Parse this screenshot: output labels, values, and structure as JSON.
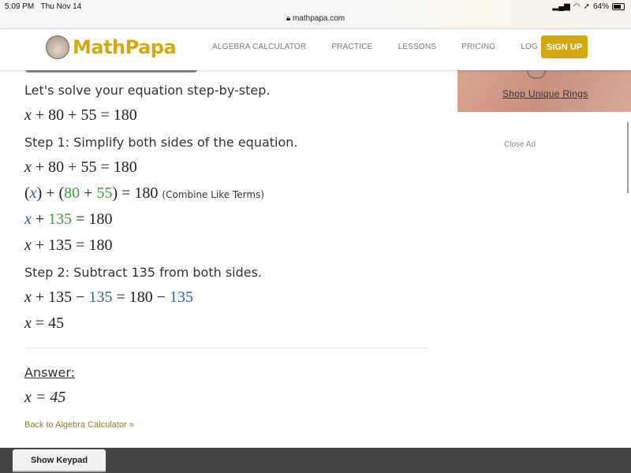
{
  "status_bar": {
    "time": "5:09 PM",
    "date": "Thu Nov 14",
    "battery": "64%",
    "url": "mathpapa.com"
  },
  "nav": {
    "logo": "MathPapa",
    "items": [
      "ALGEBRA CALCULATOR",
      "PRACTICE",
      "LESSONS",
      "PRICING",
      "LOG IN"
    ],
    "signup": "SIGN UP"
  },
  "ad": {
    "link": "Shop Unique Rings",
    "close": "Close Ad"
  },
  "solution": {
    "intro": "Let's solve your equation step-by-step.",
    "step1": "Step 1: Simplify both sides of the equation.",
    "combine_note": "(Combine Like Terms)",
    "step2": "Step 2: Subtract 135 from both sides.",
    "answer_label": "Answer:",
    "answer": "x = 45"
  },
  "colors": {
    "accent": "#d4a811",
    "green": "#3d9b3d",
    "blue": "#2a6a96"
  },
  "back_link": "Back to Algebra Calculator »",
  "keypad_button": "Show Keypad"
}
